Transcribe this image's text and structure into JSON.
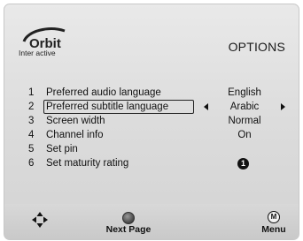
{
  "brand": {
    "name": "Orbit",
    "sub": "Inter active"
  },
  "screen_title": "OPTIONS",
  "menu": [
    {
      "num": "1",
      "label": "Preferred audio language",
      "value": "English"
    },
    {
      "num": "2",
      "label": "Preferred subtitle language",
      "value": "Arabic",
      "selected": true
    },
    {
      "num": "3",
      "label": "Screen width",
      "value": "Normal"
    },
    {
      "num": "4",
      "label": "Channel info",
      "value": "On"
    },
    {
      "num": "5",
      "label": "Set pin",
      "value": ""
    },
    {
      "num": "6",
      "label": "Set maturity rating",
      "value": ""
    }
  ],
  "maturity_badge": "1",
  "footer": {
    "next_label": "Next Page",
    "menu_key": "M",
    "menu_label": "Menu"
  },
  "icons": {
    "nav": "four-direction-arrows-icon",
    "next": "gray-circle-button-icon",
    "menu": "m-circle-button-icon",
    "left": "arrow-left-icon",
    "right": "arrow-right-icon"
  },
  "colors": {
    "background": "#dcdcdc",
    "text": "#111111",
    "footer": "#cfcfcf"
  }
}
